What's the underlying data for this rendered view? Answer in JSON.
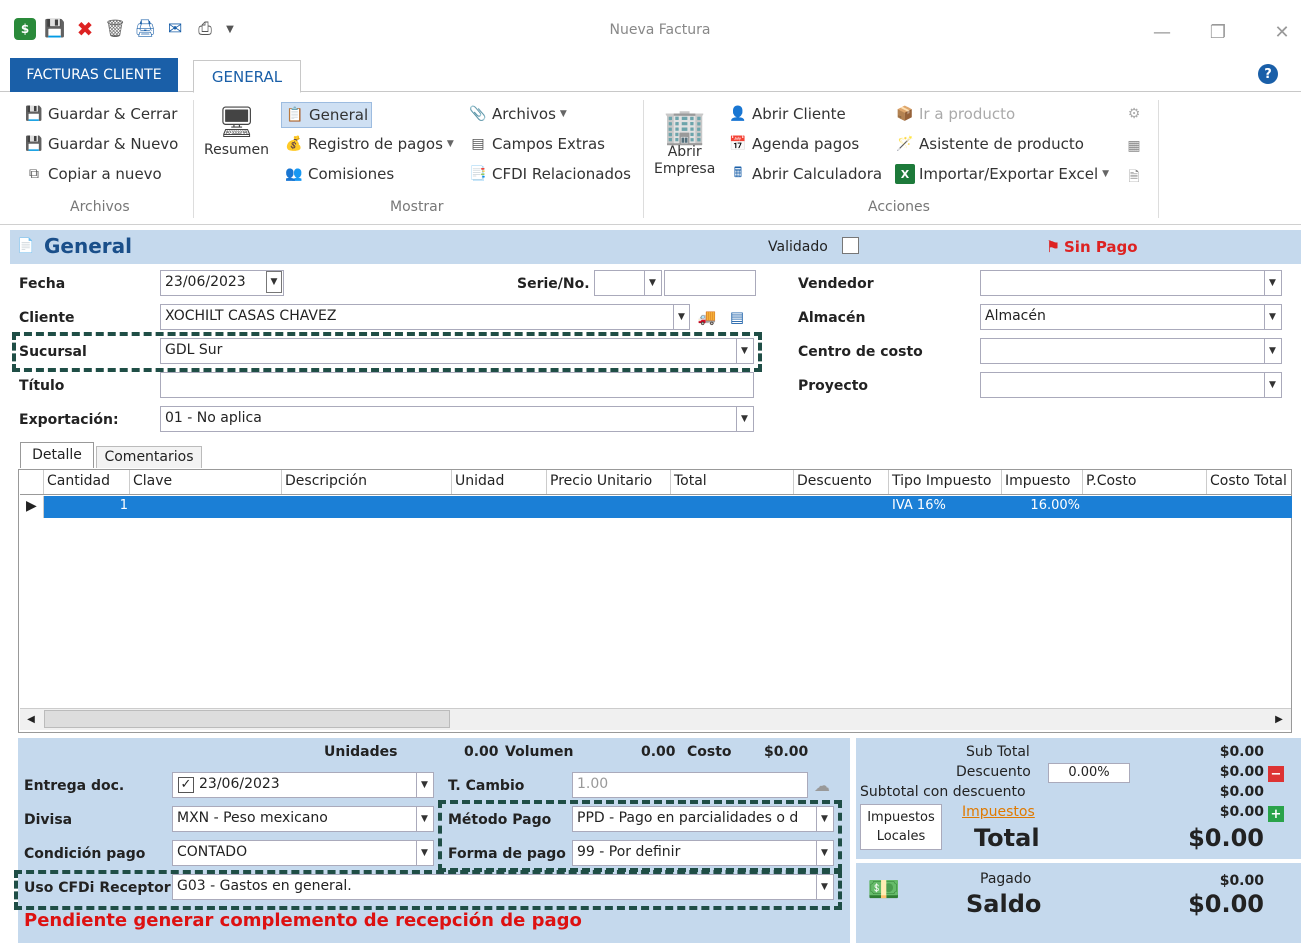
{
  "window": {
    "title": "Nueva Factura"
  },
  "tabs": {
    "facturas": "FACTURAS CLIENTE",
    "general": "GENERAL"
  },
  "ribbon": {
    "archivos": {
      "guardar_cerrar": "Guardar & Cerrar",
      "guardar_nuevo": "Guardar & Nuevo",
      "copiar": "Copiar a nuevo",
      "label": "Archivos"
    },
    "mostrar": {
      "resumen": "Resumen",
      "general": "General",
      "registro_pagos": "Registro de pagos",
      "comisiones": "Comisiones",
      "archivos": "Archivos",
      "campos_extras": "Campos Extras",
      "cfdi_rel": "CFDI Relacionados",
      "label": "Mostrar"
    },
    "acciones": {
      "abrir_empresa_1": "Abrir",
      "abrir_empresa_2": "Empresa",
      "abrir_cliente": "Abrir Cliente",
      "agenda_pagos": "Agenda pagos",
      "abrir_calc": "Abrir Calculadora",
      "ir_producto": "Ir a producto",
      "asistente": "Asistente de producto",
      "importar": "Importar/Exportar Excel",
      "label": "Acciones"
    }
  },
  "general": {
    "title": "General",
    "validado": "Validado",
    "status": "Sin Pago"
  },
  "form": {
    "fecha_label": "Fecha",
    "fecha": "23/06/2023",
    "serie_label": "Serie/No.",
    "cliente_label": "Cliente",
    "cliente": "XOCHILT CASAS CHAVEZ",
    "sucursal_label": "Sucursal",
    "sucursal": "GDL Sur",
    "titulo_label": "Título",
    "exportacion_label": "Exportación:",
    "exportacion": "01 - No aplica",
    "vendedor_label": "Vendedor",
    "almacen_label": "Almacén",
    "almacen": "Almacén",
    "centro_label": "Centro de costo",
    "proyecto_label": "Proyecto"
  },
  "subtabs": {
    "detalle": "Detalle",
    "comentarios": "Comentarios"
  },
  "grid": {
    "columns": [
      "Cantidad",
      "Clave",
      "Descripción",
      "Unidad",
      "Precio Unitario",
      "Total",
      "Descuento",
      "Tipo Impuesto",
      "Impuesto",
      "P.Costo",
      "Costo Total"
    ],
    "row": {
      "cantidad": "1",
      "tipo_impuesto": "IVA 16%",
      "impuesto": "16.00%"
    }
  },
  "totals_bar": {
    "unidades": "Unidades",
    "unidades_val": "0.00",
    "volumen": "Volumen",
    "volumen_val": "0.00",
    "costo": "Costo",
    "costo_val": "$0.00"
  },
  "bottom": {
    "entrega_label": "Entrega doc.",
    "entrega": "23/06/2023",
    "tcambio_label": "T. Cambio",
    "tcambio": "1.00",
    "divisa_label": "Divisa",
    "divisa": "MXN - Peso mexicano",
    "metodo_label": "Método Pago",
    "metodo": "PPD - Pago en parcialidades o d",
    "condicion_label": "Condición pago",
    "condicion": "CONTADO",
    "forma_label": "Forma de pago",
    "forma": "99 - Por definir",
    "uso_label": "Uso CFDi Receptor",
    "uso": "G03 - Gastos en general.",
    "pendiente": "Pendiente generar complemento de recepción de pago"
  },
  "summary": {
    "subtotal_label": "Sub Total",
    "subtotal": "$0.00",
    "descuento_label": "Descuento",
    "descuento_pct": "0.00%",
    "descuento": "$0.00",
    "subtotal_desc_label": "Subtotal con descuento",
    "subtotal_desc": "$0.00",
    "impuestos_label": "Impuestos",
    "impuestos": "$0.00",
    "imp_locales_1": "Impuestos",
    "imp_locales_2": "Locales",
    "total_label": "Total",
    "total": "$0.00",
    "pagado_label": "Pagado",
    "pagado": "$0.00",
    "saldo_label": "Saldo",
    "saldo": "$0.00"
  }
}
